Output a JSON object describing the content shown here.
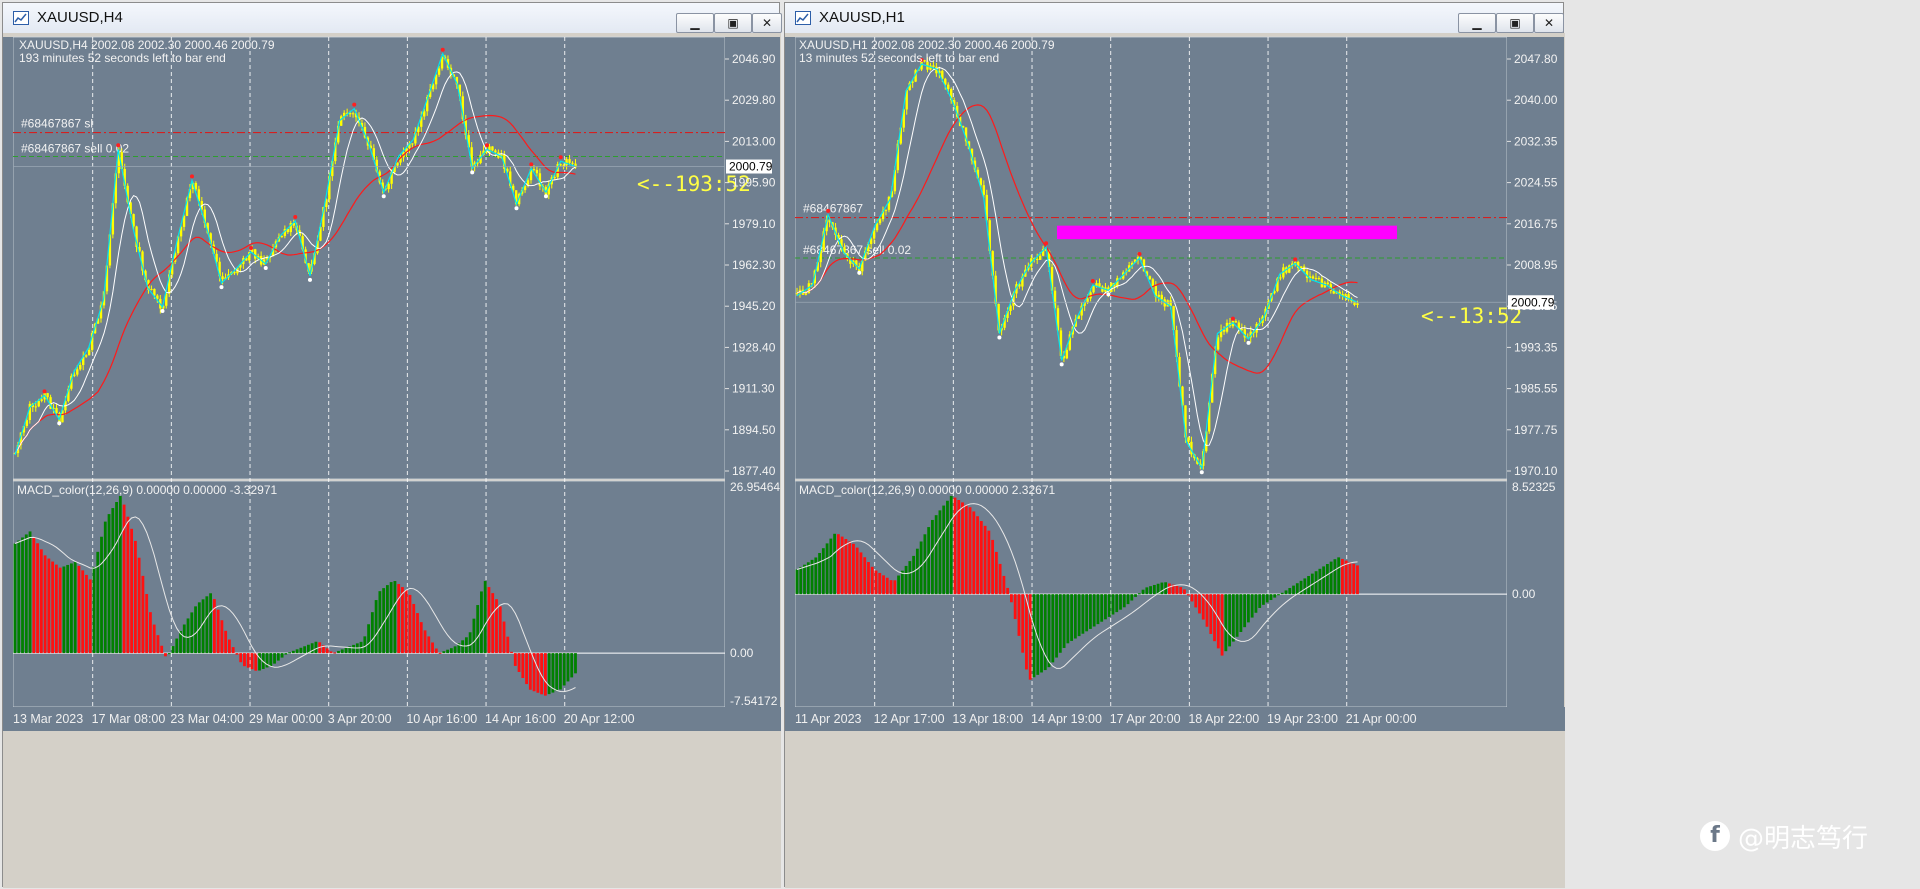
{
  "windows": [
    {
      "title": "XAUUSD,H4",
      "header_line": "XAUUSD,H4  2002.08 2002.30 2000.46 2000.79",
      "subheader_line": "193 minutes 52 seconds left to bar end",
      "sl_label": "#68467867 sl",
      "order_label": "#68467867 sell 0.02",
      "price_tag": "2000.79",
      "countdown": "<--193:52",
      "price_axis": [
        "2046.90",
        "2029.80",
        "2013.00",
        "1995.90",
        "1979.10",
        "1962.30",
        "1945.20",
        "1928.40",
        "1911.30",
        "1894.50",
        "1877.40"
      ],
      "macd_label": "MACD_color(12,26,9) 0.00000 0.00000 -3.32971",
      "macd_axis": [
        "26.95464",
        "0.00",
        "-7.54172"
      ],
      "time_axis": [
        "13 Mar 2023",
        "17 Mar 08:00",
        "23 Mar 04:00",
        "29 Mar 00:00",
        "3 Apr 20:00",
        "10 Apr 16:00",
        "14 Apr 16:00",
        "20 Apr 12:00"
      ]
    },
    {
      "title": "XAUUSD,H1",
      "header_line": "XAUUSD,H1  2002.08 2002.30 2000.46 2000.79",
      "subheader_line": "13 minutes 52 seconds left to bar end",
      "sl_label": "#68467867",
      "order_label": "#68467867 sell 0.02",
      "price_tag": "2000.79",
      "countdown": "<--13:52",
      "price_axis": [
        "2047.80",
        "2040.00",
        "2032.35",
        "2024.55",
        "2016.75",
        "2008.95",
        "2001.15",
        "1993.35",
        "1985.55",
        "1977.75",
        "1970.10"
      ],
      "macd_label": "MACD_color(12,26,9) 0.00000 0.00000 2.32671",
      "macd_axis": [
        "8.52325",
        "0.00"
      ],
      "time_axis": [
        "11 Apr 2023",
        "12 Apr 17:00",
        "13 Apr 18:00",
        "14 Apr 19:00",
        "17 Apr 20:00",
        "18 Apr 22:00",
        "19 Apr 23:00",
        "21 Apr 00:00"
      ]
    }
  ],
  "watermark": {
    "platform_icon": "f",
    "text": "@明志笃行"
  },
  "colors": {
    "chart_bg": "#6f7f90",
    "candle": "#ffff00",
    "zigzag": "#00e5ee",
    "ma_red": "#ff1a1a",
    "ma_white": "#ffffff",
    "macd_green": "#008000",
    "macd_red": "#ff1010",
    "zone_magenta": "#ff00ff",
    "countdown_yellow": "#ffff44"
  },
  "chart_data": [
    {
      "type": "candlestick-line",
      "title": "XAUUSD,H4",
      "x": [
        "13 Mar 2023",
        "17 Mar 08:00",
        "23 Mar 04:00",
        "29 Mar 00:00",
        "3 Apr 20:00",
        "10 Apr 16:00",
        "14 Apr 16:00",
        "20 Apr 12:00"
      ],
      "close_path": [
        1880,
        1900,
        1905,
        1895,
        1915,
        1925,
        1945,
        2008,
        1975,
        1950,
        1942,
        1970,
        1995,
        1975,
        1952,
        1958,
        1965,
        1960,
        1972,
        1978,
        1955,
        1985,
        2020,
        2025,
        2010,
        1990,
        2005,
        2012,
        2030,
        2048,
        2035,
        2000,
        2008,
        2005,
        1985,
        2000,
        1990,
        2003,
        2000.79
      ],
      "ylim": [
        1870,
        2055
      ],
      "sl_level": 2015,
      "order_level": 2005,
      "macd": [
        18,
        20,
        16,
        14,
        15,
        12,
        22,
        26,
        18,
        6,
        -1,
        4,
        8,
        10,
        3,
        -2,
        -3,
        -2,
        0,
        1,
        2,
        0,
        1,
        2,
        10,
        12,
        10,
        4,
        0,
        1,
        3,
        12,
        8,
        -2,
        -6,
        -7,
        -6,
        -3.33
      ],
      "macd_range": [
        -7.54172,
        26.95464
      ]
    },
    {
      "type": "candlestick-line",
      "title": "XAUUSD,H1",
      "x": [
        "11 Apr 2023",
        "12 Apr 17:00",
        "13 Apr 18:00",
        "14 Apr 19:00",
        "17 Apr 20:00",
        "18 Apr 22:00",
        "19 Apr 23:00",
        "21 Apr 00:00"
      ],
      "close_path": [
        2002,
        2004,
        2017,
        2010,
        2007,
        2015,
        2020,
        2040,
        2045,
        2044,
        2038,
        2030,
        2020,
        1995,
        2003,
        2008,
        2011,
        1990,
        1998,
        2004,
        2003,
        2006,
        2009,
        2002,
        2000,
        1975,
        1970,
        1995,
        1997,
        1994,
        1998,
        2006,
        2008,
        2005,
        2004,
        2002,
        2000.79
      ],
      "ylim": [
        1968,
        2050
      ],
      "sl_level": 2016.5,
      "order_level": 2009,
      "zone": [
        2012.5,
        2015
      ],
      "macd": [
        2,
        3,
        5,
        4,
        2,
        1,
        3,
        6,
        8,
        7,
        5,
        0,
        -7,
        -6,
        -4,
        -3,
        -2,
        -1,
        0.5,
        1,
        0.5,
        -2,
        -5,
        -3,
        -1,
        0,
        1,
        2,
        3,
        2.33
      ],
      "macd_range": [
        -8.5,
        8.52325
      ]
    }
  ]
}
